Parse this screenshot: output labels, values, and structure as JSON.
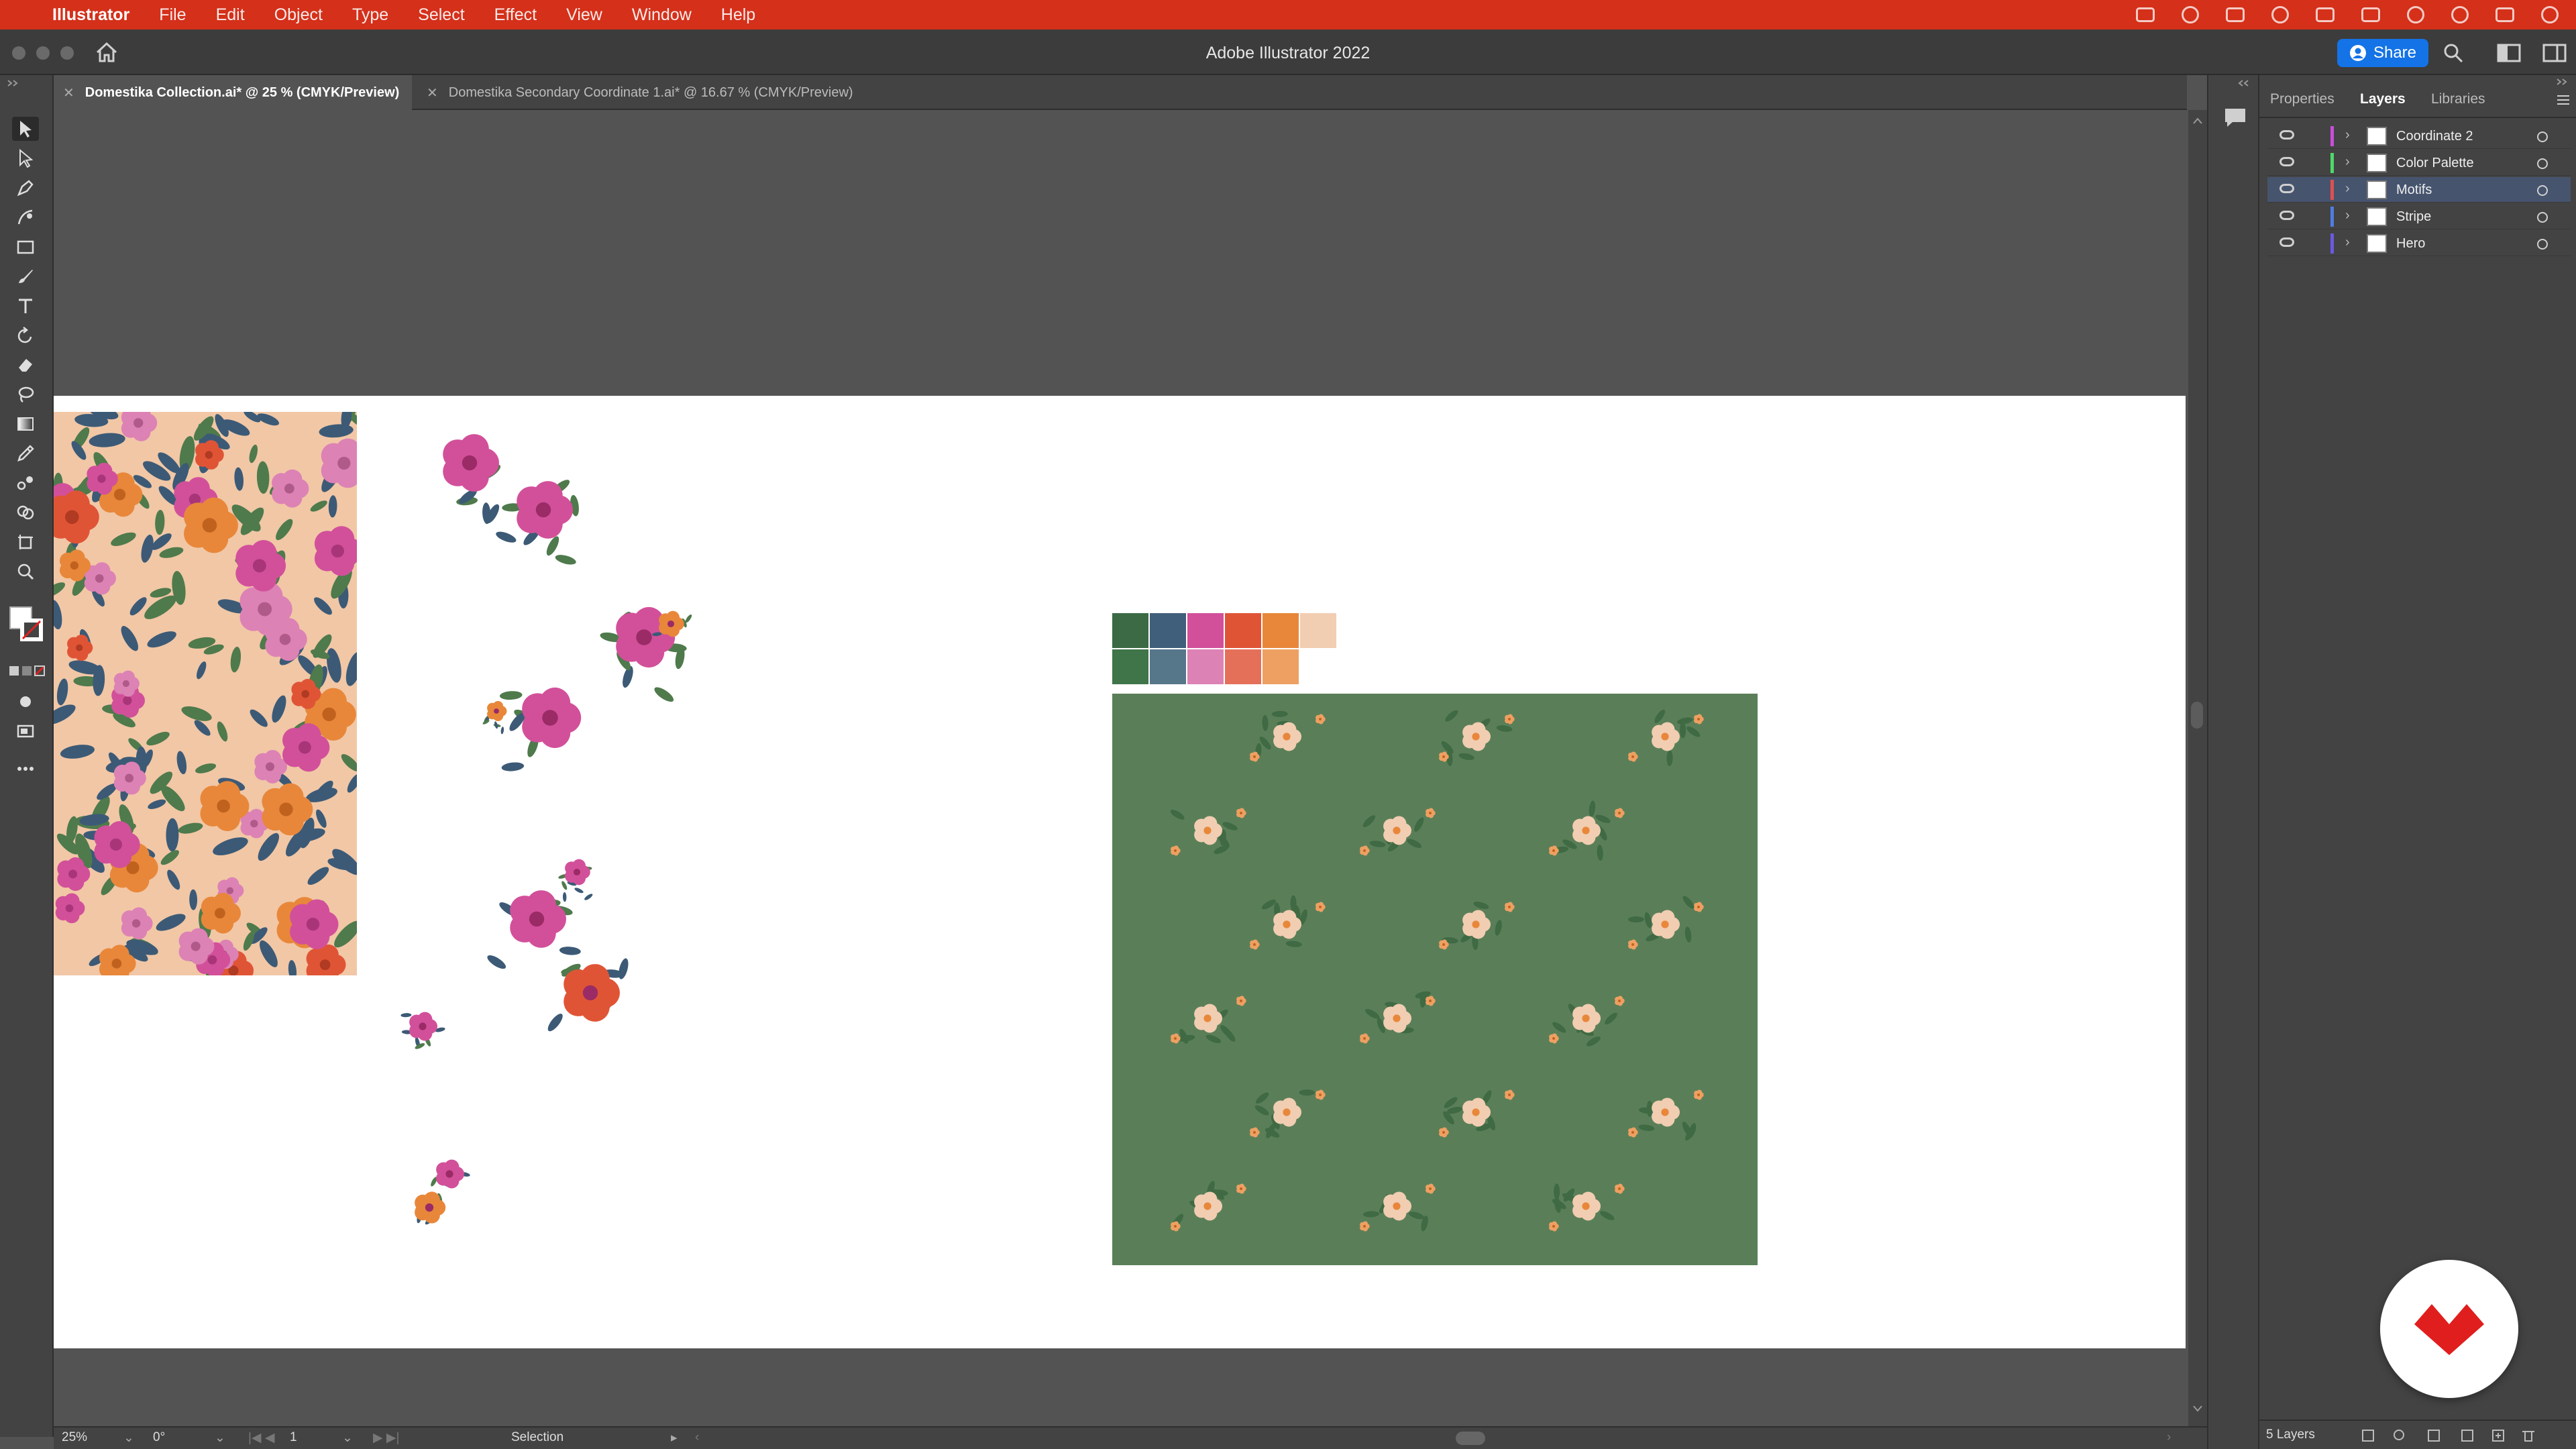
{
  "menubar": {
    "app": "Illustrator",
    "items": [
      "File",
      "Edit",
      "Object",
      "Type",
      "Select",
      "Effect",
      "View",
      "Window",
      "Help"
    ]
  },
  "titlebar": {
    "title": "Adobe Illustrator 2022",
    "share_label": "Share"
  },
  "tabs": [
    {
      "label": "Domestika Collection.ai* @ 25 % (CMYK/Preview)",
      "active": true
    },
    {
      "label": "Domestika Secondary Coordinate 1.ai* @ 16.67 % (CMYK/Preview)",
      "active": false
    }
  ],
  "panel": {
    "tabs": [
      "Properties",
      "Layers",
      "Libraries"
    ],
    "active_tab": "Layers",
    "layers": [
      {
        "name": "Coordinate 2",
        "color": "#c84fd8",
        "selected": false
      },
      {
        "name": "Color Palette",
        "color": "#4fd86a",
        "selected": false
      },
      {
        "name": "Motifs",
        "color": "#e05050",
        "selected": true
      },
      {
        "name": "Stripe",
        "color": "#4f7de0",
        "selected": false
      },
      {
        "name": "Hero",
        "color": "#6a5ae0",
        "selected": false
      }
    ],
    "footer": "5 Layers"
  },
  "status": {
    "zoom": "25%",
    "rotate": "0°",
    "artboard": "1",
    "tool": "Selection"
  },
  "palette": {
    "row1": [
      "#3b6a45",
      "#3f5f7a",
      "#d2509a",
      "#e05436",
      "#e8873a",
      "#f1cdb2"
    ],
    "row2": [
      "#3f7549",
      "#56768a",
      "#dd82b5",
      "#e4705a",
      "#eda062"
    ]
  },
  "colors": {
    "accent": "#1473e6",
    "menubar": "#d4301a",
    "pattern_bg": "#5a7f58"
  }
}
